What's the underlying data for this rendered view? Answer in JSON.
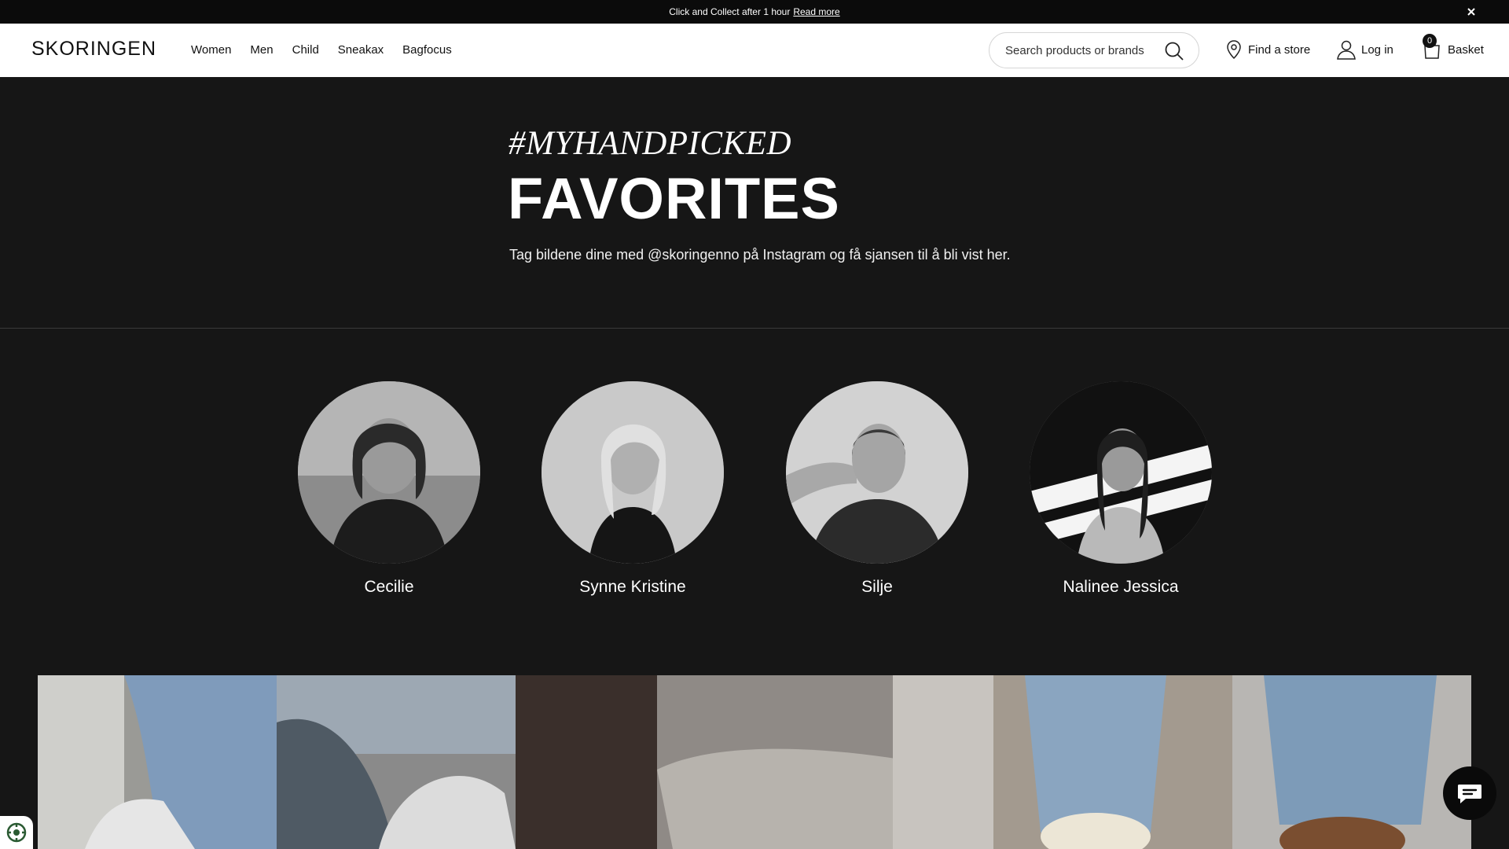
{
  "announcement": {
    "text": "Click and Collect after 1 hour",
    "link": "Read more"
  },
  "header": {
    "logo": "SKORINGEN",
    "nav": [
      "Women",
      "Men",
      "Child",
      "Sneakax",
      "Bagfocus"
    ],
    "search_placeholder": "Search products or brands",
    "find_store": "Find a store",
    "login": "Log in",
    "basket": "Basket",
    "basket_count": "0"
  },
  "hero": {
    "hashtag": "#MYHANDPICKED",
    "title": "FAVORITES",
    "text": "Tag bildene dine med @skoringenno på Instagram og få sjansen til å bli vist her."
  },
  "influencers": [
    {
      "name": "Cecilie"
    },
    {
      "name": "Synne Kristine"
    },
    {
      "name": "Silje"
    },
    {
      "name": "Nalinee Jessica"
    }
  ],
  "colors": {
    "background": "#161616",
    "header": "#ffffff",
    "announcement": "#0b0b0b"
  },
  "icons": {
    "search": "search-icon",
    "store": "location-pin-icon",
    "login": "user-icon",
    "basket": "bag-icon",
    "close": "close-icon",
    "chat": "chat-bubble-icon",
    "cookie": "cookie-settings-icon"
  }
}
